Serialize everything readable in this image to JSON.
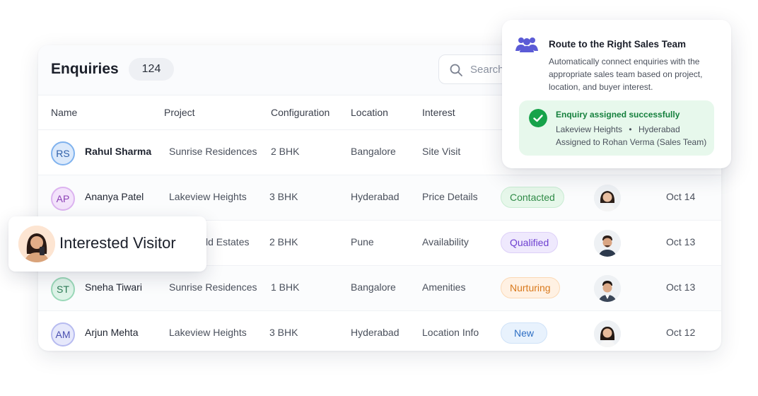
{
  "header": {
    "title": "Enquiries",
    "count": "124"
  },
  "search": {
    "placeholder": "Search"
  },
  "columns": [
    "Name",
    "Project",
    "Configuration",
    "Location",
    "Interest"
  ],
  "rows": [
    {
      "initials": "RS",
      "name": "Rahul Sharma",
      "project": "Sunrise Residences",
      "configuration": "2 BHK",
      "location": "Bangalore",
      "interest": "Site Visit",
      "status": "",
      "date": ""
    },
    {
      "initials": "AP",
      "name": "Ananya Patel",
      "project": "Lakeview Heights",
      "configuration": "3 BHK",
      "location": "Hyderabad",
      "interest": "Price Details",
      "status": "Contacted",
      "date": "Oct 14"
    },
    {
      "initials": "",
      "name": "",
      "project": "ld Estates",
      "configuration": "2 BHK",
      "location": "Pune",
      "interest": "Availability",
      "status": "Qualified",
      "date": "Oct 13"
    },
    {
      "initials": "ST",
      "name": "Sneha Tiwari",
      "project": "Sunrise Residences",
      "configuration": "1 BHK",
      "location": "Bangalore",
      "interest": "Amenities",
      "status": "Nurturing",
      "date": "Oct 13"
    },
    {
      "initials": "AM",
      "name": "Arjun Mehta",
      "project": "Lakeview Heights",
      "configuration": "3 BHK",
      "location": "Hyderabad",
      "interest": "Location Info",
      "status": "New",
      "date": "Oct 12"
    }
  ],
  "route_popup": {
    "title": "Route to the Right Sales Team",
    "description": "Automatically connect enquiries with the appropriate sales team based on project, location, and buyer interest.",
    "success_title": "Enquiry assigned successfully",
    "success_project": "Lakeview Heights",
    "success_city": "Hyderabad",
    "success_separator": "•",
    "success_assigned": "Assigned to Rohan Verma (Sales Team)"
  },
  "visitor_tag": {
    "label": "Interested Visitor"
  },
  "colors": {
    "contacted_bg": "#e6f7ea",
    "contacted_fg": "#2f8a47",
    "qualified_bg": "#efe9fd",
    "qualified_fg": "#6d3fd0",
    "nurturing_bg": "#fff1e3",
    "nurturing_fg": "#d9791c",
    "new_bg": "#e8f2fd",
    "new_fg": "#2f6fc4",
    "success_bg": "#e7f8ec",
    "accent_team": "#5b5bd6"
  },
  "icons": {
    "search": "search-icon",
    "team": "team-icon",
    "check": "check-circle-icon"
  }
}
